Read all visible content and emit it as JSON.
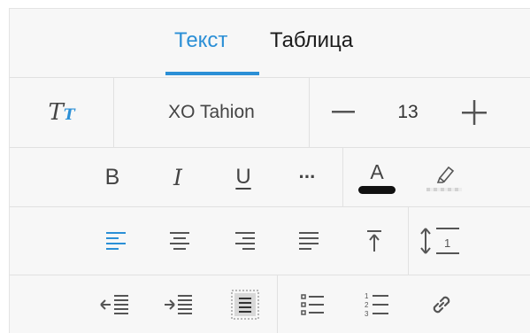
{
  "tabs": {
    "text_label": "Текст",
    "table_label": "Таблица",
    "active": "text"
  },
  "font_row": {
    "style_icon_big": "T",
    "style_icon_small": "T",
    "font_name": "XO Tahion",
    "size": "13",
    "minus_label": "—",
    "plus_label": "+"
  },
  "format_row": {
    "bold": "B",
    "italic": "I",
    "underline": "U",
    "more": "···",
    "font_color_letter": "A",
    "font_color": "#111111"
  },
  "colors": {
    "accent": "#2b8fd6",
    "icon_gray": "#555555",
    "divider": "#e1e1e1",
    "panel_bg": "#f7f7f7"
  },
  "align_row": {
    "icons": [
      "align-left-icon",
      "align-center-icon",
      "align-right-icon",
      "align-justify-icon",
      "vertical-align-top-icon",
      "line-spacing-icon"
    ],
    "active": "align-left-icon",
    "line_spacing_value": "1"
  },
  "list_row": {
    "icons": [
      "decrease-indent-icon",
      "increase-indent-icon",
      "text-wrap-icon",
      "bulleted-list-icon",
      "numbered-list-icon",
      "link-icon"
    ],
    "numbered_digits": [
      "1",
      "2",
      "3"
    ]
  }
}
